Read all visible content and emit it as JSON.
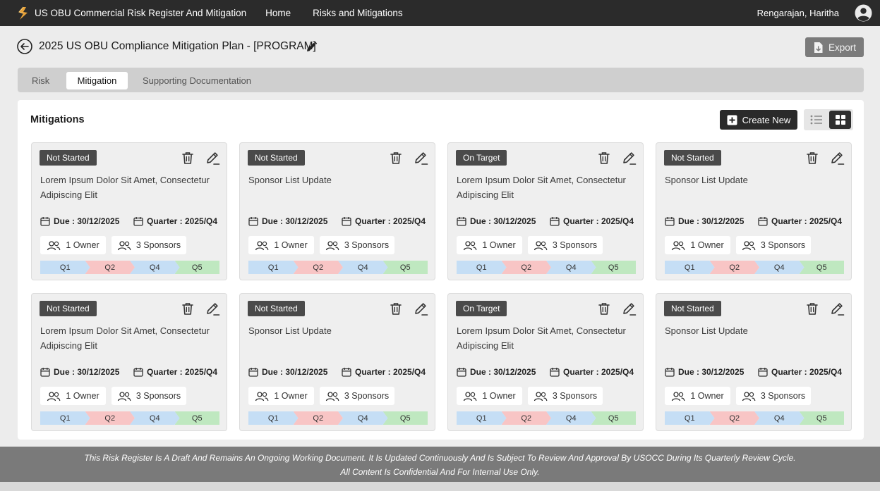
{
  "app": {
    "title": "US OBU Commercial Risk Register And Mitigation",
    "nav": [
      "Home",
      "Risks and Mitigations"
    ],
    "user_name": "Rengarajan, Haritha"
  },
  "header": {
    "page_title": "2025 US OBU Compliance Mitigation Plan - [PROGRAM]",
    "export_label": "Export"
  },
  "tabs": [
    {
      "label": "Risk",
      "active": false
    },
    {
      "label": "Mitigation",
      "active": true
    },
    {
      "label": "Supporting Documentation",
      "active": false
    }
  ],
  "panel": {
    "title": "Mitigations",
    "create_label": "Create New",
    "view_mode": "grid"
  },
  "status_colors": {
    "Q1": "#c5def5",
    "Q2": "#f8c5c5",
    "Q4": "#c5def5",
    "Q5": "#bfe8c0"
  },
  "cards": [
    {
      "status": "Not Started",
      "title": "Lorem Ipsum Dolor Sit Amet, Consectetur Adipiscing Elit",
      "due": "Due : 30/12/2025",
      "quarter": "Quarter : 2025/Q4",
      "owners": "1 Owner",
      "sponsors": "3 Sponsors",
      "quarters": [
        "Q1",
        "Q2",
        "Q4",
        "Q5"
      ]
    },
    {
      "status": "Not Started",
      "title": "Sponsor List Update",
      "due": "Due : 30/12/2025",
      "quarter": "Quarter : 2025/Q4",
      "owners": "1 Owner",
      "sponsors": "3 Sponsors",
      "quarters": [
        "Q1",
        "Q2",
        "Q4",
        "Q5"
      ]
    },
    {
      "status": "On Target",
      "title": "Lorem Ipsum Dolor Sit Amet, Consectetur Adipiscing Elit",
      "due": "Due : 30/12/2025",
      "quarter": "Quarter : 2025/Q4",
      "owners": "1 Owner",
      "sponsors": "3 Sponsors",
      "quarters": [
        "Q1",
        "Q2",
        "Q4",
        "Q5"
      ]
    },
    {
      "status": "Not Started",
      "title": "Sponsor List Update",
      "due": "Due : 30/12/2025",
      "quarter": "Quarter : 2025/Q4",
      "owners": "1 Owner",
      "sponsors": "3 Sponsors",
      "quarters": [
        "Q1",
        "Q2",
        "Q4",
        "Q5"
      ]
    },
    {
      "status": "Not Started",
      "title": "Lorem Ipsum Dolor Sit Amet, Consectetur Adipiscing Elit",
      "due": "Due : 30/12/2025",
      "quarter": "Quarter : 2025/Q4",
      "owners": "1 Owner",
      "sponsors": "3 Sponsors",
      "quarters": [
        "Q1",
        "Q2",
        "Q4",
        "Q5"
      ]
    },
    {
      "status": "Not Started",
      "title": "Sponsor List Update",
      "due": "Due : 30/12/2025",
      "quarter": "Quarter : 2025/Q4",
      "owners": "1 Owner",
      "sponsors": "3 Sponsors",
      "quarters": [
        "Q1",
        "Q2",
        "Q4",
        "Q5"
      ]
    },
    {
      "status": "On Target",
      "title": "Lorem Ipsum Dolor Sit Amet, Consectetur Adipiscing Elit",
      "due": "Due : 30/12/2025",
      "quarter": "Quarter : 2025/Q4",
      "owners": "1 Owner",
      "sponsors": "3 Sponsors",
      "quarters": [
        "Q1",
        "Q2",
        "Q4",
        "Q5"
      ]
    },
    {
      "status": "Not Started",
      "title": "Sponsor List Update",
      "due": "Due : 30/12/2025",
      "quarter": "Quarter : 2025/Q4",
      "owners": "1 Owner",
      "sponsors": "3 Sponsors",
      "quarters": [
        "Q1",
        "Q2",
        "Q4",
        "Q5"
      ]
    }
  ],
  "footer": {
    "line1": "This Risk Register Is A Draft And Remains An Ongoing Working Document. It Is Updated Continuously And Is Subject To Review And Approval By USOCC During Its Quarterly Review Cycle.",
    "line2": "All Content Is Confidential And For Internal Use Only."
  }
}
